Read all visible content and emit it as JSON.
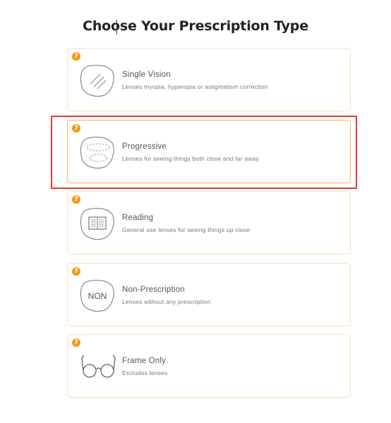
{
  "header": {
    "title": "Choose Your Prescription Type"
  },
  "help_badge_text": "?",
  "options": [
    {
      "title": "Single Vision",
      "description": "Lenses myopia, hyperopia or astigmatism correction",
      "icon": "single-vision-lens-icon",
      "selected": false
    },
    {
      "title": "Progressive",
      "description": "Lenses for seeing things both close and far away",
      "icon": "progressive-lens-icon",
      "selected": true
    },
    {
      "title": "Reading",
      "description": "General use lenses for seeing things up close",
      "icon": "book-lens-icon",
      "selected": false
    },
    {
      "title": "Non-Prescription",
      "description": "Lenses without any prescription",
      "icon": "non-prescription-lens-icon",
      "icon_text": "NON",
      "selected": false
    },
    {
      "title": "Frame Only",
      "description": "Excludes lenses",
      "icon": "glasses-frame-icon",
      "selected": false
    }
  ],
  "colors": {
    "accent": "#f39a1b",
    "card_border": "#f9e0bb",
    "selected_border": "#f0b455",
    "highlight": "#e53935"
  }
}
